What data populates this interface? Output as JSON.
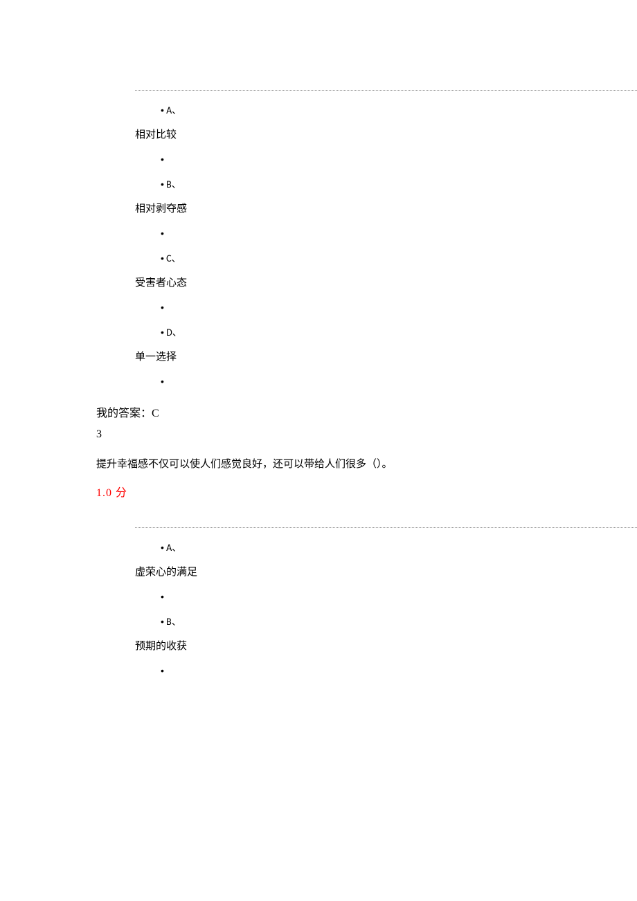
{
  "q2": {
    "options": {
      "a_label": "A、",
      "a_text": "相对比较",
      "b_label": "B、",
      "b_text": "相对剥夺感",
      "c_label": "C、",
      "c_text": "受害者心态",
      "d_label": "D、",
      "d_text": "单一选择"
    },
    "answer_label": "我的答案：C"
  },
  "q3": {
    "number": "3",
    "text": "提升幸福感不仅可以使人们感觉良好，还可以带给人们很多（）。",
    "score": "1.0  分",
    "options": {
      "a_label": "A、",
      "a_text": "虚荣心的满足",
      "b_label": "B、",
      "b_text": "预期的收获"
    }
  },
  "bullet_char": "•"
}
